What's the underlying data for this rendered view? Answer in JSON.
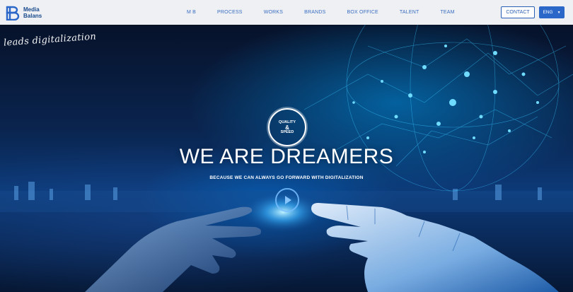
{
  "brand": {
    "line1": "Media",
    "line2": "Balans",
    "logo_icon": "mb-logo-icon"
  },
  "nav": {
    "items": [
      "M B",
      "PROCESS",
      "WORKS",
      "BRANDS",
      "BOX OFFICE",
      "TALENT",
      "TEAM"
    ]
  },
  "header": {
    "contact_label": "CONTACT",
    "lang_label": "ENG",
    "lang_icon": "caret-down-icon"
  },
  "hero": {
    "tagline": "leads digitalization",
    "badge": {
      "top": "QUALITY",
      "amp": "&",
      "bottom": "SPEED"
    },
    "headline": "WE ARE DREAMERS",
    "subline": "BECAUSE WE CAN ALWAYS GO FORWARD WITH DIGITALIZATION",
    "play_icon": "play-icon"
  },
  "colors": {
    "brand_blue": "#2a67c9",
    "nav_text": "#3a6dc0",
    "header_bg": "#eef0f4",
    "hero_dark": "#061733"
  }
}
